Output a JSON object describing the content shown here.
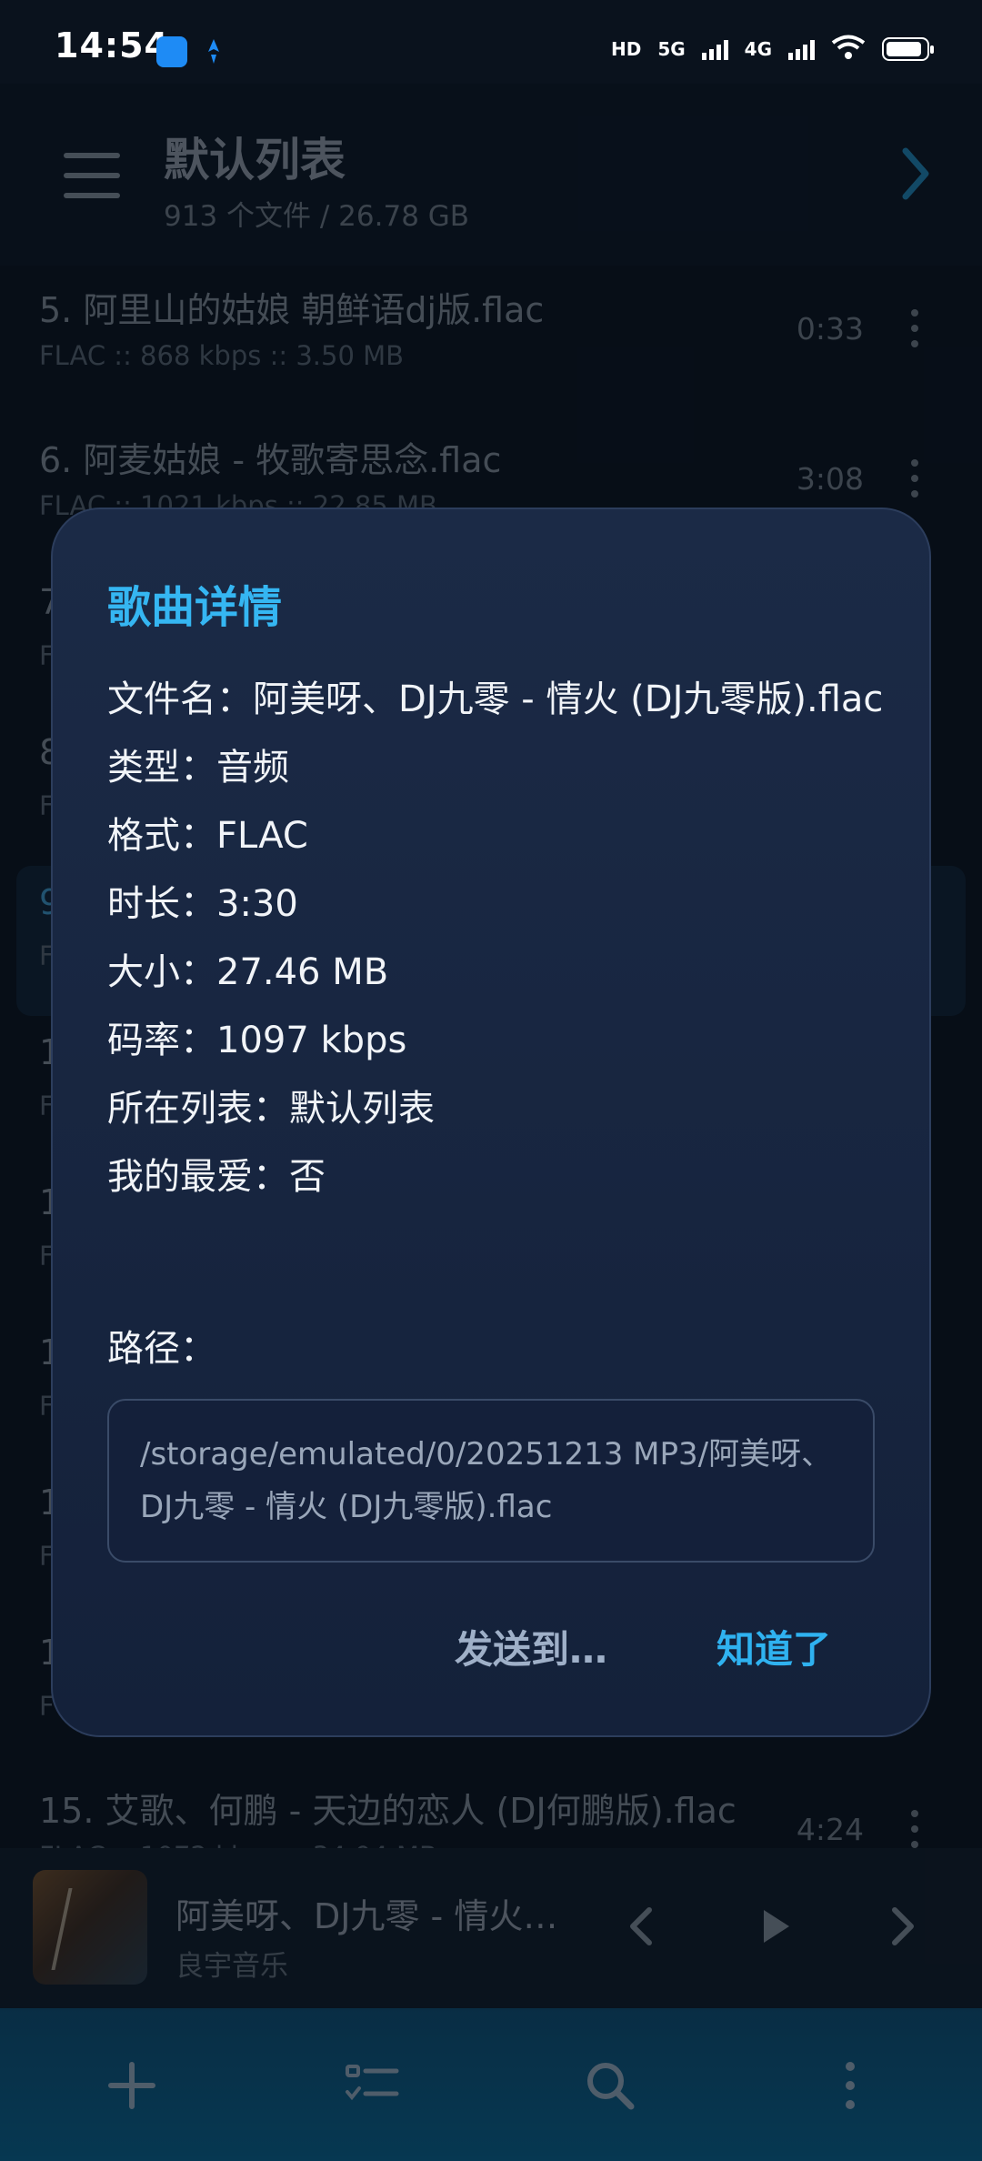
{
  "status_bar": {
    "time": "14:54",
    "tag_hd": "HD",
    "tag_5g": "5G",
    "tag_4g": "4G"
  },
  "header": {
    "title": "默认列表",
    "subtitle": "913 个文件 / 26.78 GB"
  },
  "list": [
    {
      "name": "5. 阿里山的姑娘 朝鲜语dj版.flac",
      "meta": "FLAC :: 868 kbps :: 3.50 MB",
      "duration": "0:33"
    },
    {
      "name": "6. 阿麦姑娘 - 牧歌寄思念.flac",
      "meta": "FLAC :: 1021 kbps :: 22.85 MB",
      "duration": "3:08"
    },
    {
      "name": "7.",
      "meta": "F",
      "duration": ""
    },
    {
      "name": "8.",
      "meta": "F",
      "duration": ""
    },
    {
      "name": "9.",
      "meta": "F",
      "duration": ""
    },
    {
      "name": "1",
      "meta": "F",
      "duration": ""
    },
    {
      "name": "1",
      "meta": "F",
      "duration": ""
    },
    {
      "name": "1",
      "meta": "F",
      "duration": ""
    },
    {
      "name": "1",
      "meta": "F",
      "duration": ""
    },
    {
      "name": "1",
      "meta": "F",
      "duration": ""
    },
    {
      "name": "15. 艾歌、何鹏 - 天边的恋人 (DJ何鹏版).flac",
      "meta": "FLAC :: 1072 kbps :: 34.04 MB",
      "duration": "4:24"
    }
  ],
  "player": {
    "title": "阿美呀、DJ九零 - 情火…",
    "artist": "良宇音乐"
  },
  "dialog": {
    "title": "歌曲详情",
    "filename": "文件名：阿美呀、DJ九零 - 情火 (DJ九零版).flac",
    "type": "类型：音频",
    "format": "格式：FLAC",
    "duration": "时长：3:30",
    "size": "大小：27.46 MB",
    "bitrate": "码率：1097 kbps",
    "playlist": "所在列表：默认列表",
    "favorite": "我的最爱：否",
    "path_label": "路径：",
    "path": "/storage/emulated/0/20251213 MP3/阿美呀、DJ九零 - 情火 (DJ九零版).flac",
    "send_label": "发送到…",
    "ok_label": "知道了"
  },
  "colors": {
    "accent": "#35b6f2",
    "dialog_bg": "#1b2a46",
    "bottom_bar": "#0a5f8a"
  },
  "icons": {
    "menu": "menu-icon",
    "forward": "chevron-right-icon",
    "more": "more-vertical-icon",
    "prev": "prev-icon",
    "play": "play-icon",
    "next": "next-icon",
    "add": "plus-icon",
    "list": "checklist-icon",
    "search": "search-icon",
    "overflow": "more-vertical-icon"
  }
}
